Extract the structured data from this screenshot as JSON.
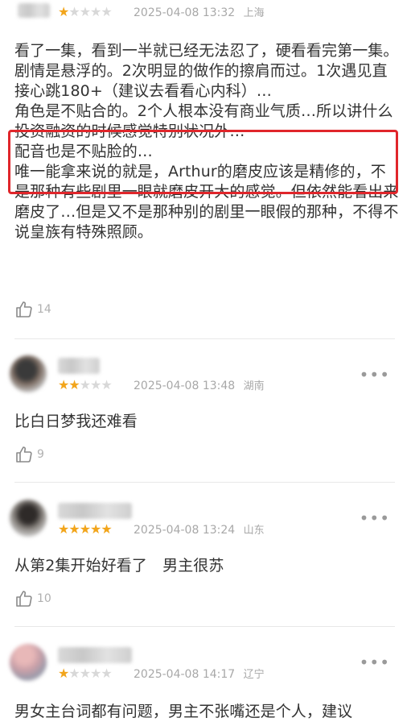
{
  "comments": [
    {
      "stars": 1,
      "date": "2025-04-08",
      "time": "13:32",
      "location": "上海",
      "paragraphs": [
        "看了一集，看到一半就已经无法忍了，硬看看完第一集。",
        "剧情是悬浮的。2次明显的做作的擦肩而过。1次遇见直接心跳180+（建议去看看心内科）…",
        "角色是不贴合的。2个人根本没有商业气质…所以讲什么投资融资的时候感觉特别状况外…",
        "配音也是不贴脸的…",
        "唯一能拿来说的就是，Arthur的磨皮应该是精修的，不是那种有些剧里一眼就磨皮开大的感觉。但依然能看出来磨皮了…但是又不是那种别的剧里一眼假的那种，不得不说皇族有特殊照顾。"
      ],
      "likes": "14"
    },
    {
      "stars": 2,
      "date": "2025-04-08",
      "time": "13:48",
      "location": "湖南",
      "text": "比白日梦我还难看",
      "likes": "9",
      "more": "•••"
    },
    {
      "stars": 5,
      "date": "2025-04-08",
      "time": "13:24",
      "location": "山东",
      "text": "从第2集开始好看了　男主很苏",
      "likes": "10",
      "more": "•••"
    },
    {
      "stars": 1,
      "date": "2025-04-08",
      "time": "14:17",
      "location": "辽宁",
      "text": "男女主台词都有问题，男主不张嘴还是个人，建议",
      "more": "•••"
    }
  ]
}
